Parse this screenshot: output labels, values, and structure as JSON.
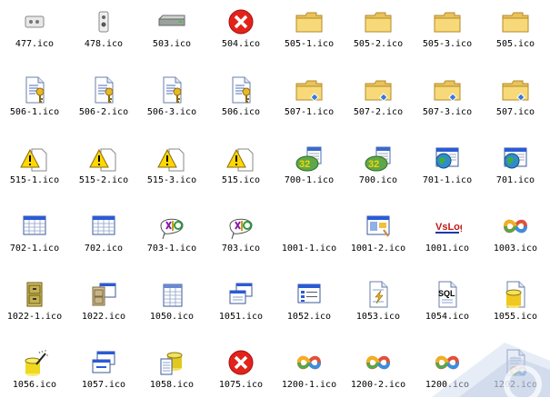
{
  "icons": [
    {
      "label": "477.ico",
      "icon": "drive-icon"
    },
    {
      "label": "478.ico",
      "icon": "device-icon"
    },
    {
      "label": "503.ico",
      "icon": "hard-drive-icon"
    },
    {
      "label": "504.ico",
      "icon": "error-icon"
    },
    {
      "label": "505-1.ico",
      "icon": "folder-icon"
    },
    {
      "label": "505-2.ico",
      "icon": "folder-icon"
    },
    {
      "label": "505-3.ico",
      "icon": "folder-icon"
    },
    {
      "label": "505.ico",
      "icon": "folder-icon"
    },
    {
      "label": "506-1.ico",
      "icon": "key-document-icon"
    },
    {
      "label": "506-2.ico",
      "icon": "key-document-icon"
    },
    {
      "label": "506-3.ico",
      "icon": "key-document-icon"
    },
    {
      "label": "506.ico",
      "icon": "key-document-icon"
    },
    {
      "label": "507-1.ico",
      "icon": "shared-folder-icon"
    },
    {
      "label": "507-2.ico",
      "icon": "shared-folder-icon"
    },
    {
      "label": "507-3.ico",
      "icon": "shared-folder-icon"
    },
    {
      "label": "507.ico",
      "icon": "shared-folder-icon"
    },
    {
      "label": "515-1.ico",
      "icon": "warning-document-icon"
    },
    {
      "label": "515-2.ico",
      "icon": "warning-document-icon"
    },
    {
      "label": "515-3.ico",
      "icon": "warning-document-icon"
    },
    {
      "label": "515.ico",
      "icon": "warning-document-icon"
    },
    {
      "label": "700-1.ico",
      "icon": "calendar-32-icon"
    },
    {
      "label": "700.ico",
      "icon": "calendar-32-icon"
    },
    {
      "label": "701-1.ico",
      "icon": "globe-window-icon"
    },
    {
      "label": "701.ico",
      "icon": "globe-window-icon"
    },
    {
      "label": "702-1.ico",
      "icon": "spreadsheet-window-icon"
    },
    {
      "label": "702.ico",
      "icon": "spreadsheet-window-icon"
    },
    {
      "label": "703-1.ico",
      "icon": "speech-bubble-icon"
    },
    {
      "label": "703.ico",
      "icon": "speech-bubble-icon"
    },
    {
      "label": "1001-1.ico",
      "icon": "none"
    },
    {
      "label": "1001-2.ico",
      "icon": "app-window-icon"
    },
    {
      "label": "1001.ico",
      "icon": "vslog-icon"
    },
    {
      "label": "1003.ico",
      "icon": "infinity-icon"
    },
    {
      "label": "1022-1.ico",
      "icon": "filing-cabinet-icon"
    },
    {
      "label": "1022.ico",
      "icon": "cabinet-window-icon"
    },
    {
      "label": "1050.ico",
      "icon": "table-document-icon"
    },
    {
      "label": "1051.ico",
      "icon": "windows-stack-icon"
    },
    {
      "label": "1052.ico",
      "icon": "list-window-icon"
    },
    {
      "label": "1053.ico",
      "icon": "lightning-document-icon"
    },
    {
      "label": "1054.ico",
      "icon": "sql-document-icon"
    },
    {
      "label": "1055.ico",
      "icon": "database-document-icon"
    },
    {
      "label": "1056.ico",
      "icon": "magic-database-icon"
    },
    {
      "label": "1057.ico",
      "icon": "window-stack-icon"
    },
    {
      "label": "1058.ico",
      "icon": "database-stack-icon"
    },
    {
      "label": "1075.ico",
      "icon": "error-icon"
    },
    {
      "label": "1200-1.ico",
      "icon": "infinity-icon"
    },
    {
      "label": "1200-2.ico",
      "icon": "infinity-icon"
    },
    {
      "label": "1200.ico",
      "icon": "infinity-icon"
    },
    {
      "label": "1202.ico",
      "icon": "infinity-document-icon"
    }
  ],
  "vslog_text": "VsLog",
  "sql_text": "SQL",
  "calendar_text": "32"
}
